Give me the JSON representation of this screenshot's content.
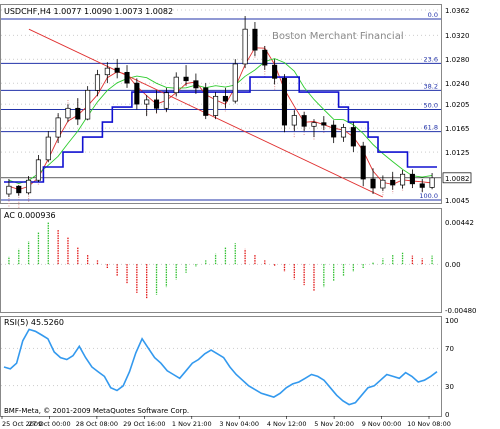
{
  "chart_data": [
    {
      "panel": "price",
      "type": "candlestick",
      "title": "USDCHF,H4  1.0077 1.0090 1.0073 1.0082",
      "watermark": "Boston Merchant Financial",
      "ylim": [
        1.0045,
        1.0362
      ],
      "yticks": [
        "1.0362",
        "1.0320",
        "1.0280",
        "1.0240",
        "1.0205",
        "1.0165",
        "1.0125",
        "1.0045"
      ],
      "last_price": "1.0082",
      "fib_levels": [
        {
          "label": "0.0",
          "value": 1.0347
        },
        {
          "label": "23.6",
          "value": 1.0273
        },
        {
          "label": "38.2",
          "value": 1.0228
        },
        {
          "label": "50.0",
          "value": 1.0196
        },
        {
          "label": "61.8",
          "value": 1.0159
        },
        {
          "label": "100.0",
          "value": 1.0045
        }
      ],
      "candles": [
        [
          1.0055,
          1.008,
          1.005,
          1.0068
        ],
        [
          1.0068,
          1.007,
          1.0052,
          1.0057
        ],
        [
          1.0057,
          1.0085,
          1.0054,
          1.0078
        ],
        [
          1.0078,
          1.012,
          1.0075,
          1.0112
        ],
        [
          1.0112,
          1.016,
          1.0108,
          1.015
        ],
        [
          1.015,
          1.019,
          1.014,
          1.0182
        ],
        [
          1.0182,
          1.0205,
          1.0175,
          1.0198
        ],
        [
          1.0198,
          1.0215,
          1.017,
          1.018
        ],
        [
          1.018,
          1.0235,
          1.0178,
          1.0228
        ],
        [
          1.0228,
          1.0262,
          1.0218,
          1.0254
        ],
        [
          1.0254,
          1.0275,
          1.024,
          1.0265
        ],
        [
          1.0265,
          1.028,
          1.0248,
          1.0258
        ],
        [
          1.0258,
          1.027,
          1.0232,
          1.024
        ],
        [
          1.024,
          1.0248,
          1.0196,
          1.0205
        ],
        [
          1.0205,
          1.022,
          1.0185,
          1.0212
        ],
        [
          1.0212,
          1.0228,
          1.019,
          1.0198
        ],
        [
          1.0198,
          1.0232,
          1.0192,
          1.0224
        ],
        [
          1.0224,
          1.0258,
          1.0218,
          1.025
        ],
        [
          1.025,
          1.027,
          1.0236,
          1.0244
        ],
        [
          1.0244,
          1.0256,
          1.0222,
          1.0232
        ],
        [
          1.0232,
          1.024,
          1.018,
          1.0186
        ],
        [
          1.0186,
          1.0225,
          1.018,
          1.0218
        ],
        [
          1.0218,
          1.0232,
          1.0198,
          1.021
        ],
        [
          1.021,
          1.028,
          1.0206,
          1.0272
        ],
        [
          1.0272,
          1.0352,
          1.0265,
          1.033
        ],
        [
          1.033,
          1.0342,
          1.0285,
          1.0295
        ],
        [
          1.0295,
          1.0302,
          1.0262,
          1.027
        ],
        [
          1.027,
          1.028,
          1.0238,
          1.0248
        ],
        [
          1.0248,
          1.0255,
          1.0158,
          1.017
        ],
        [
          1.017,
          1.0195,
          1.016,
          1.0186
        ],
        [
          1.0186,
          1.0192,
          1.016,
          1.0168
        ],
        [
          1.0168,
          1.018,
          1.015,
          1.0174
        ],
        [
          1.0174,
          1.0185,
          1.0162,
          1.017
        ],
        [
          1.017,
          1.0178,
          1.014,
          1.015
        ],
        [
          1.015,
          1.0172,
          1.0142,
          1.0166
        ],
        [
          1.0166,
          1.0175,
          1.0125,
          1.0135
        ],
        [
          1.0135,
          1.0142,
          1.0068,
          1.008
        ],
        [
          1.008,
          1.0098,
          1.0055,
          1.0065
        ],
        [
          1.0065,
          1.0086,
          1.006,
          1.0078
        ],
        [
          1.0078,
          1.0092,
          1.0062,
          1.007
        ],
        [
          1.007,
          1.0095,
          1.0064,
          1.0088
        ],
        [
          1.0088,
          1.0096,
          1.0065,
          1.0072
        ],
        [
          1.0072,
          1.008,
          1.0058,
          1.0066
        ],
        [
          1.0066,
          1.009,
          1.0063,
          1.0082
        ]
      ]
    },
    {
      "panel": "ac",
      "type": "bar",
      "title": "AC 0.000936",
      "ylim": [
        -0.0048,
        0.00442
      ],
      "yticks": [
        "0.00442",
        "0.00",
        "-0.00480"
      ],
      "values": [
        0.0008,
        0.0016,
        0.0024,
        0.0034,
        0.0044,
        0.0036,
        0.0028,
        0.0018,
        0.001,
        0.0004,
        -0.0004,
        -0.0012,
        -0.002,
        -0.003,
        -0.0036,
        -0.0032,
        -0.0024,
        -0.0016,
        -0.0009,
        -0.0003,
        0.0004,
        0.0011,
        0.0018,
        0.0022,
        0.0016,
        0.001,
        0.0004,
        -0.0002,
        -0.0008,
        -0.0016,
        -0.0022,
        -0.0028,
        -0.0024,
        -0.0018,
        -0.0012,
        -0.0008,
        -0.0004,
        0.0002,
        0.0006,
        0.001,
        0.0012,
        0.0009,
        0.0006,
        0.0009
      ]
    },
    {
      "panel": "rsi",
      "type": "line",
      "title": "RSI(5) 45.5260",
      "ylim": [
        0,
        100
      ],
      "yticks": [
        "100",
        "70",
        "30",
        "0"
      ],
      "levels": [
        70,
        30
      ],
      "values": [
        50,
        48,
        54,
        78,
        90,
        88,
        84,
        80,
        66,
        60,
        58,
        62,
        72,
        60,
        50,
        45,
        40,
        28,
        25,
        30,
        45,
        65,
        80,
        70,
        60,
        54,
        46,
        42,
        38,
        46,
        54,
        58,
        64,
        68,
        64,
        60,
        50,
        42,
        36,
        30,
        26,
        22,
        20,
        18,
        22,
        28,
        32,
        34,
        38,
        42,
        40,
        36,
        28,
        20,
        14,
        10,
        12,
        20,
        28,
        30,
        36,
        42,
        40,
        38,
        44,
        40,
        34,
        36,
        40,
        45
      ]
    }
  ],
  "x_labels": [
    "25 Oct 2009",
    "27 Oct 00:00",
    "28 Oct 08:00",
    "29 Oct 16:00",
    "1 Nov 21:00",
    "3 Nov 04:00",
    "4 Nov 12:00",
    "5 Nov 20:00",
    "9 Nov 00:00",
    "10 Nov 08:00"
  ],
  "footer": "BMF-Meta, © 2001-2009 MetaQuotes Software Corp.",
  "colors": {
    "bull": "#e01010",
    "bear": "#2cbf2c",
    "fib": "#2233aa",
    "rsi": "#3399ee",
    "cloud": "#e0a0a0",
    "grid": "#999999"
  }
}
